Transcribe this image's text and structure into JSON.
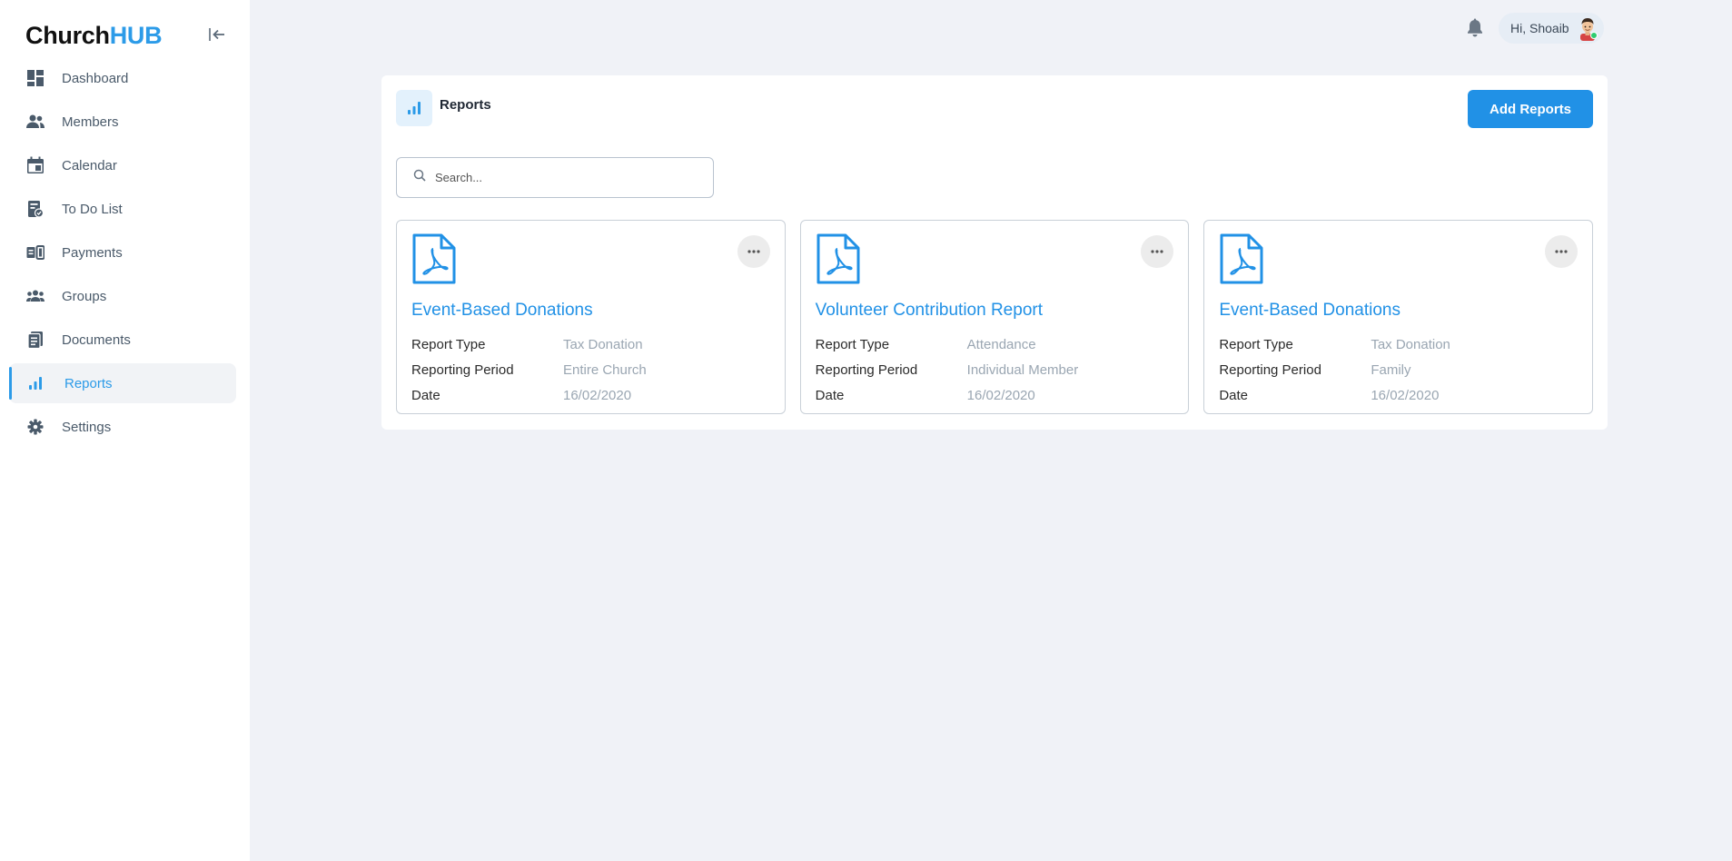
{
  "app": {
    "logo_part1": "Church",
    "logo_part2": "HUB"
  },
  "sidebar": {
    "items": [
      {
        "label": "Dashboard",
        "icon": "dashboard-icon"
      },
      {
        "label": "Members",
        "icon": "members-icon"
      },
      {
        "label": "Calendar",
        "icon": "calendar-icon"
      },
      {
        "label": "To Do List",
        "icon": "todo-icon"
      },
      {
        "label": "Payments",
        "icon": "payments-icon"
      },
      {
        "label": "Groups",
        "icon": "groups-icon"
      },
      {
        "label": "Documents",
        "icon": "documents-icon"
      },
      {
        "label": "Reports",
        "icon": "reports-icon",
        "active": true
      },
      {
        "label": "Settings",
        "icon": "settings-icon"
      }
    ]
  },
  "header": {
    "greeting": "Hi, Shoaib"
  },
  "main": {
    "title": "Reports",
    "add_button": "Add Reports",
    "search_placeholder": "Search...",
    "search_value": ""
  },
  "reports": [
    {
      "title": "Event-Based Donations",
      "fields": [
        {
          "label": "Report Type",
          "value": "Tax Donation"
        },
        {
          "label": "Reporting Period",
          "value": "Entire Church"
        },
        {
          "label": "Date",
          "value": "16/02/2020"
        }
      ]
    },
    {
      "title": "Volunteer Contribution Report",
      "fields": [
        {
          "label": "Report Type",
          "value": "Attendance"
        },
        {
          "label": "Reporting Period",
          "value": "Individual Member"
        },
        {
          "label": "Date",
          "value": "16/02/2020"
        }
      ]
    },
    {
      "title": "Event-Based Donations",
      "fields": [
        {
          "label": "Report Type",
          "value": "Tax Donation"
        },
        {
          "label": "Reporting Period",
          "value": "Family"
        },
        {
          "label": "Date",
          "value": "16/02/2020"
        }
      ]
    }
  ],
  "colors": {
    "accent": "#2191e6",
    "logo_accent": "#2c9be8",
    "background": "#f0f2f7",
    "muted_value": "#9aa6b2",
    "online": "#2ecc71"
  }
}
